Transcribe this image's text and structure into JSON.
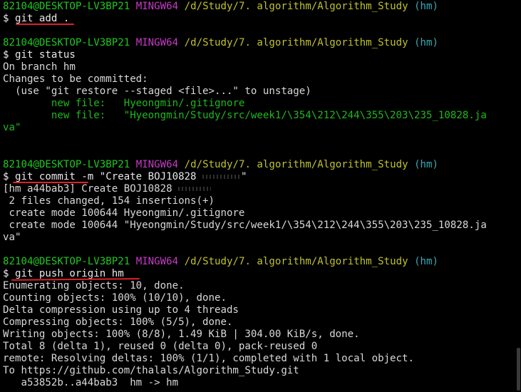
{
  "prompts": [
    {
      "user_host": "82104@DESKTOP-LV3BP21",
      "system": "MINGW64",
      "path": "/d/Study/7. algorithm/Algorithm_Study",
      "branch": "(hm)"
    },
    {
      "user_host": "82104@DESKTOP-LV3BP21",
      "system": "MINGW64",
      "path": "/d/Study/7. algorithm/Algorithm_Study",
      "branch": "(hm)"
    },
    {
      "user_host": "82104@DESKTOP-LV3BP21",
      "system": "MINGW64",
      "path": "/d/Study/7. algorithm/Algorithm_Study",
      "branch": "(hm)"
    },
    {
      "user_host": "82104@DESKTOP-LV3BP21",
      "system": "MINGW64",
      "path": "/d/Study/7. algorithm/Algorithm_Study",
      "branch": "(hm)"
    }
  ],
  "commands": [
    "$ git add .",
    "$ git status",
    "$ git commit -m \"Create BOJ10828",
    "$ git push origin hm"
  ],
  "commit_message_tail": "\"",
  "status_output": {
    "line1": "On branch hm",
    "line2": "Changes to be committed:",
    "line3": "  (use \"git restore --staged <file>...\" to unstage)",
    "new_file_label": "        new file:",
    "file1": "   Hyeongmin/.gitignore",
    "file2": "   \"Hyeongmin/Study/src/week1/\\354\\212\\244\\355\\203\\235_10828.ja",
    "file2_wrap": "va\""
  },
  "commit_output": {
    "line1": "[hm a44bab3] Create BOJ10828",
    "line2": " 2 files changed, 154 insertions(+)",
    "line3": " create mode 100644 Hyeongmin/.gitignore",
    "line4": " create mode 100644 \"Hyeongmin/Study/src/week1/\\354\\212\\244\\355\\203\\235_10828.ja",
    "line5": "va\""
  },
  "push_output": [
    "Enumerating objects: 10, done.",
    "Counting objects: 100% (10/10), done.",
    "Delta compression using up to 4 threads",
    "Compressing objects: 100% (5/5), done.",
    "Writing objects: 100% (8/8), 1.49 KiB | 304.00 KiB/s, done.",
    "Total 8 (delta 1), reused 0 (delta 0), pack-reused 0",
    "remote: Resolving deltas: 100% (1/1), completed with 1 local object.",
    "To https://github.com/thalals/Algorithm_Study.git",
    "   a53852b..a44bab3  hm -> hm"
  ],
  "colors": {
    "background": "#000000",
    "user_host": "#1fc81f",
    "system": "#c83ac8",
    "path": "#c0c030",
    "branch": "#3aa8b8",
    "underline": "#e0202a"
  }
}
